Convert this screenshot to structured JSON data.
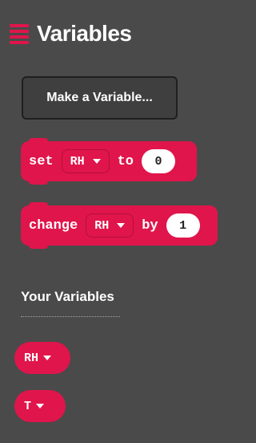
{
  "header": {
    "title": "Variables",
    "icon": "hamburger-menu-icon"
  },
  "colors": {
    "background": "#4a4a4a",
    "accent": "#e0154b",
    "block": "#e0154b",
    "input": "#ffffff"
  },
  "toolbar": {
    "make_variable_label": "Make a Variable..."
  },
  "blocks": [
    {
      "type": "set",
      "prefix": "set",
      "variable": "RH",
      "joiner": "to",
      "value": "0"
    },
    {
      "type": "change",
      "prefix": "change",
      "variable": "RH",
      "joiner": "by",
      "value": "1"
    }
  ],
  "variables_section": {
    "title": "Your Variables",
    "items": [
      {
        "name": "RH"
      },
      {
        "name": "T"
      }
    ]
  }
}
